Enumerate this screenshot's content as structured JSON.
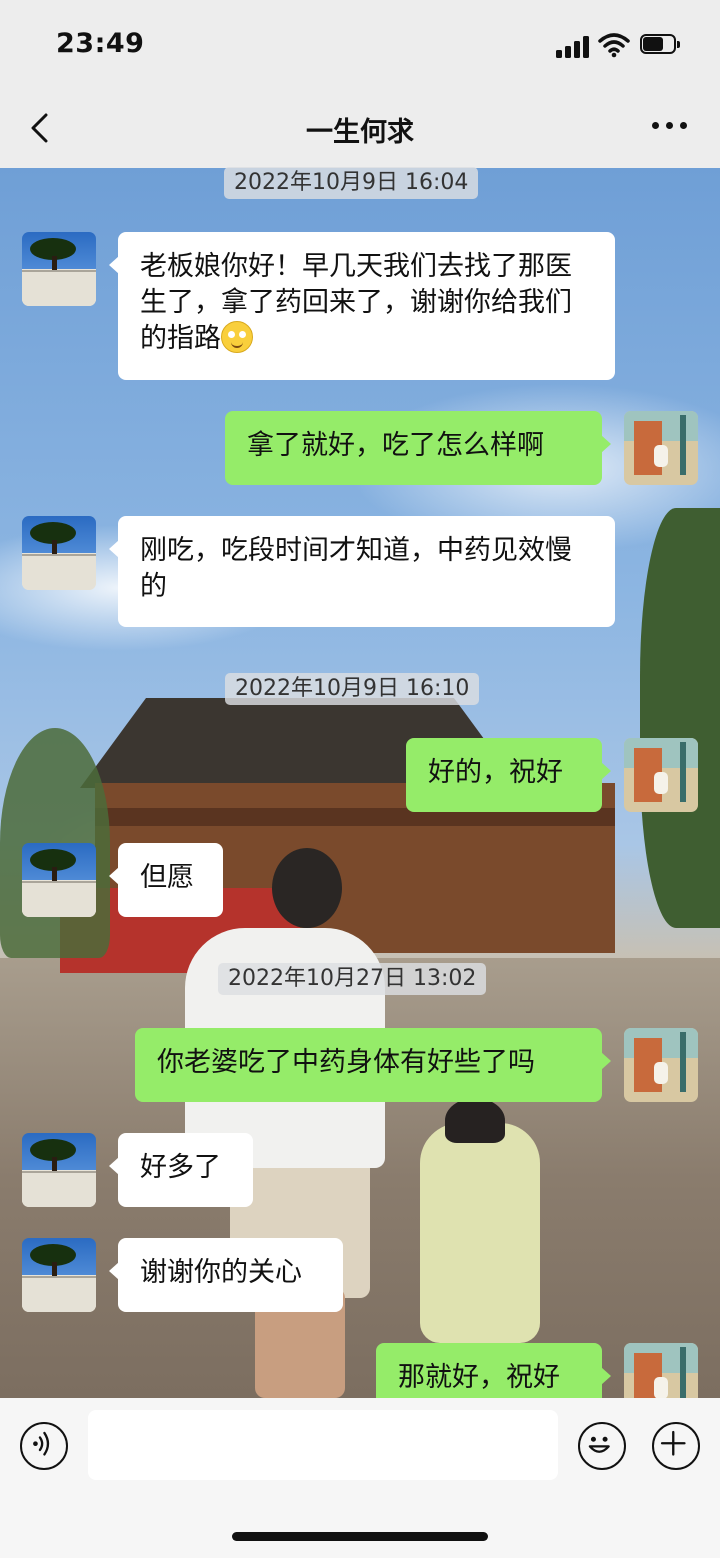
{
  "status_bar": {
    "time": "23:49",
    "icons": [
      "signal-icon",
      "wifi-icon",
      "battery-icon"
    ]
  },
  "nav": {
    "title": "一生何求",
    "back_icon": "chevron-left-icon",
    "more_icon": "more-dots-icon"
  },
  "timestamps": [
    "2022年10月9日 16:04",
    "2022年10月9日 16:10",
    "2022年10月27日 13:02"
  ],
  "messages": [
    {
      "side": "left",
      "text": "老板娘你好！早几天我们去找了那医生了，拿了药回来了，谢谢你给我们的指路",
      "emoji": "smile-emoji"
    },
    {
      "side": "right",
      "text": "拿了就好，吃了怎么样啊"
    },
    {
      "side": "left",
      "text": "刚吃，吃段时间才知道，中药见效慢的"
    },
    {
      "side": "right",
      "text": "好的，祝好"
    },
    {
      "side": "left",
      "text": "但愿"
    },
    {
      "side": "right",
      "text": "你老婆吃了中药身体有好些了吗"
    },
    {
      "side": "left",
      "text": "好多了"
    },
    {
      "side": "left",
      "text": "谢谢你的关心"
    },
    {
      "side": "right",
      "text": "那就好，祝好"
    }
  ],
  "input_bar": {
    "message_value": "",
    "icons": [
      "voice-icon",
      "emoji-icon",
      "plus-icon"
    ]
  },
  "colors": {
    "outgoing_bubble": "#95ec69",
    "incoming_bubble": "#ffffff",
    "bar_background": "#ededed"
  }
}
